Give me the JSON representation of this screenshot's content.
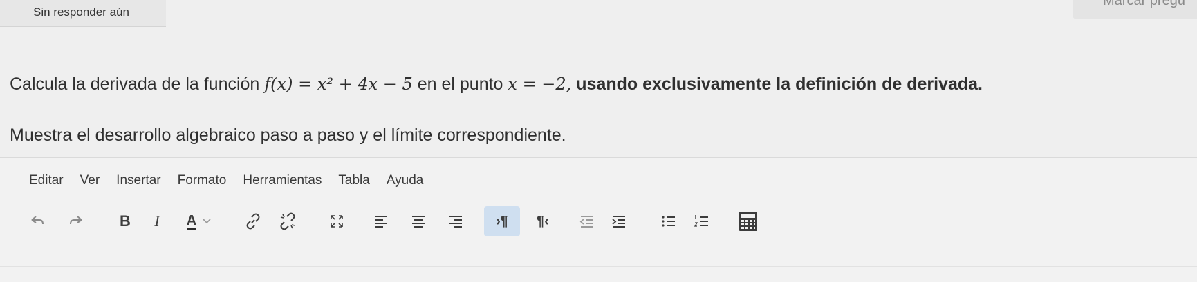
{
  "status": {
    "text": "Sin responder aún"
  },
  "flag": {
    "text": "Marcar pregu"
  },
  "question": {
    "p1_intro": "Calcula la derivada de la función",
    "p1_func": "f(x) = x² + 4x − 5",
    "p1_mid": "en el punto",
    "p1_point": "x = −2,",
    "p1_bold": "usando exclusivamente la definición de derivada.",
    "p2": "Muestra el desarrollo algebraico paso a paso y el límite correspondiente."
  },
  "editor": {
    "menu": [
      "Editar",
      "Ver",
      "Insertar",
      "Formato",
      "Herramientas",
      "Tabla",
      "Ayuda"
    ],
    "toolbar": {
      "bold": "B",
      "italic": "I",
      "font_color": "A",
      "ltr": "›¶",
      "rtl": "¶‹"
    }
  },
  "colors": {
    "active_button_bg": "#cfdff0",
    "accent": "#2b2b2b"
  }
}
